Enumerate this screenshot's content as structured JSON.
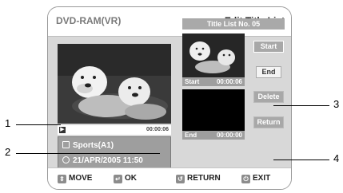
{
  "header": {
    "source": "DVD-RAM(VR)",
    "title": "Edit Title List",
    "title_icon": "diamond-icon"
  },
  "preview": {
    "time": "00:00:06"
  },
  "info": {
    "title": "Sports(A1)",
    "datetime": "21/APR/2005 11:50"
  },
  "title_list": {
    "label": "Title List No. 05"
  },
  "start_marker": {
    "label": "Start",
    "time": "00:00:06"
  },
  "end_marker": {
    "label": "End",
    "time": "00:00:00"
  },
  "buttons": {
    "start": "Start",
    "end": "End",
    "delete": "Delete",
    "return": "Return"
  },
  "footer": {
    "move": "MOVE",
    "ok": "OK",
    "return": "RETURN",
    "exit": "EXIT"
  },
  "callouts": {
    "c1": "1",
    "c2": "2",
    "c3": "3",
    "c4": "4"
  }
}
